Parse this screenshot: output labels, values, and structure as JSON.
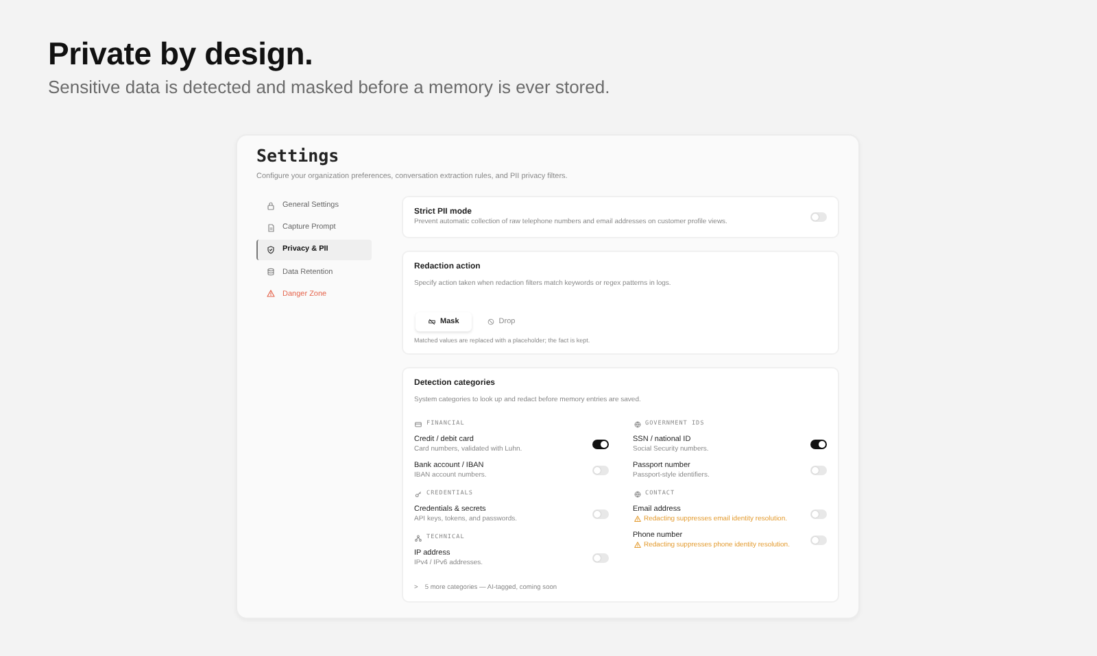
{
  "headline": "Private by design.",
  "subheadline": "Sensitive data is detected and masked before a memory is ever stored.",
  "settings": {
    "title": "Settings",
    "description": "Configure your organization preferences, conversation extraction rules, and PII privacy filters.",
    "nav": [
      {
        "label": "General Settings",
        "selected": false,
        "kind": "normal"
      },
      {
        "label": "Capture Prompt",
        "selected": false,
        "kind": "normal"
      },
      {
        "label": "Privacy & PII",
        "selected": true,
        "kind": "normal"
      },
      {
        "label": "Data Retention",
        "selected": false,
        "kind": "normal"
      },
      {
        "label": "Danger Zone",
        "selected": false,
        "kind": "danger"
      }
    ],
    "strict": {
      "title": "Strict PII mode",
      "description": "Prevent automatic collection of raw telephone numbers and email addresses on customer profile views.",
      "on": false
    },
    "redaction": {
      "title": "Redaction action",
      "description": "Specify action taken when redaction filters match keywords or regex patterns in logs.",
      "options": [
        {
          "label": "Mask",
          "selected": true
        },
        {
          "label": "Drop",
          "selected": false
        }
      ],
      "note": "Matched values are replaced with a placeholder; the fact is kept."
    },
    "detection": {
      "title": "Detection categories",
      "description": "System categories to look up and redact before memory entries are saved.",
      "columns": [
        [
          {
            "heading": "FINANCIAL",
            "items": [
              {
                "title": "Credit / debit card",
                "description": "Card numbers, validated with Luhn.",
                "kind": "info",
                "on": true
              },
              {
                "title": "Bank account / IBAN",
                "description": "IBAN account numbers.",
                "kind": "info",
                "on": false
              }
            ]
          },
          {
            "heading": "CREDENTIALS",
            "items": [
              {
                "title": "Credentials & secrets",
                "description": "API keys, tokens, and passwords.",
                "kind": "info",
                "on": false
              }
            ]
          },
          {
            "heading": "TECHNICAL",
            "items": [
              {
                "title": "IP address",
                "description": "IPv4 / IPv6 addresses.",
                "kind": "info",
                "on": false
              }
            ]
          }
        ],
        [
          {
            "heading": "GOVERNMENT IDS",
            "items": [
              {
                "title": "SSN / national ID",
                "description": "Social Security numbers.",
                "kind": "info",
                "on": true
              },
              {
                "title": "Passport number",
                "description": "Passport-style identifiers.",
                "kind": "info",
                "on": false
              }
            ]
          },
          {
            "heading": "CONTACT",
            "items": [
              {
                "title": "Email address",
                "description": "Redacting suppresses email identity resolution.",
                "kind": "warning",
                "on": false
              },
              {
                "title": "Phone number",
                "description": "Redacting suppresses phone identity resolution.",
                "kind": "warning",
                "on": false
              }
            ]
          }
        ]
      ],
      "more_chevron": ">",
      "more": "5 more categories — AI-tagged, coming soon"
    }
  }
}
